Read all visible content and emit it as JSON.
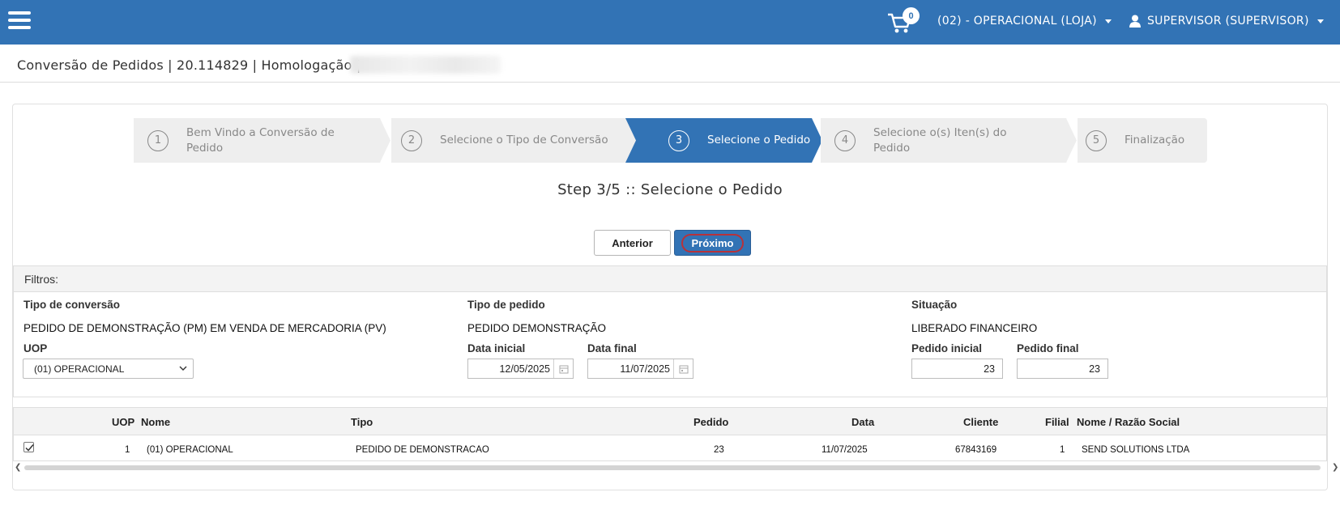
{
  "topbar": {
    "cart_count": "0",
    "store_label": "(02) - OPERACIONAL (LOJA)",
    "user_label": "SUPERVISOR (SUPERVISOR)"
  },
  "header": {
    "title": "Conversão de Pedidos | 20.114829 | Homologação |"
  },
  "stepper": {
    "steps": [
      {
        "number": "1",
        "label_line1": "Bem Vindo a Conversão de",
        "label_line2": "Pedido"
      },
      {
        "number": "2",
        "label_line1": "Selecione o Tipo de Conversão",
        "label_line2": ""
      },
      {
        "number": "3",
        "label_line1": "Selecione o Pedido",
        "label_line2": ""
      },
      {
        "number": "4",
        "label_line1": "Selecione o(s) Iten(s) do",
        "label_line2": "Pedido"
      },
      {
        "number": "5",
        "label_line1": "Finalização",
        "label_line2": ""
      }
    ],
    "active_step": 3
  },
  "step_heading": "Step 3/5 :: Selecione o Pedido",
  "buttons": {
    "prev": "Anterior",
    "next": "Próximo"
  },
  "filters": {
    "title": "Filtros:",
    "tipo_conversao_label": "Tipo de conversão",
    "tipo_conversao_value": "PEDIDO DE DEMONSTRAÇÃO (PM) EM VENDA DE MERCADORIA (PV)",
    "tipo_pedido_label": "Tipo de pedido",
    "tipo_pedido_value": "PEDIDO DEMONSTRAÇÃO",
    "situacao_label": "Situação",
    "situacao_value": "LIBERADO FINANCEIRO",
    "uop_label": "UOP",
    "uop_value": "(01) OPERACIONAL",
    "data_inicial_label": "Data inicial",
    "data_inicial_value": "12/05/2025",
    "data_final_label": "Data final",
    "data_final_value": "11/07/2025",
    "pedido_inicial_label": "Pedido inicial",
    "pedido_inicial_value": "23",
    "pedido_final_label": "Pedido final",
    "pedido_final_value": "23"
  },
  "table": {
    "headers": {
      "uop": "UOP",
      "nome": "Nome",
      "tipo": "Tipo",
      "pedido": "Pedido",
      "data": "Data",
      "cliente": "Cliente",
      "filial": "Filial",
      "razao": "Nome / Razão Social"
    },
    "rows": [
      {
        "checked": true,
        "uop": "1",
        "nome": "(01) OPERACIONAL",
        "tipo": "PEDIDO DE DEMONSTRACAO",
        "pedido": "23",
        "data": "11/07/2025",
        "cliente": "67843169",
        "filial": "1",
        "razao": "SEND SOLUTIONS LTDA"
      }
    ]
  },
  "colors": {
    "primary": "#3273b5",
    "highlight_ring": "#b8323a"
  }
}
